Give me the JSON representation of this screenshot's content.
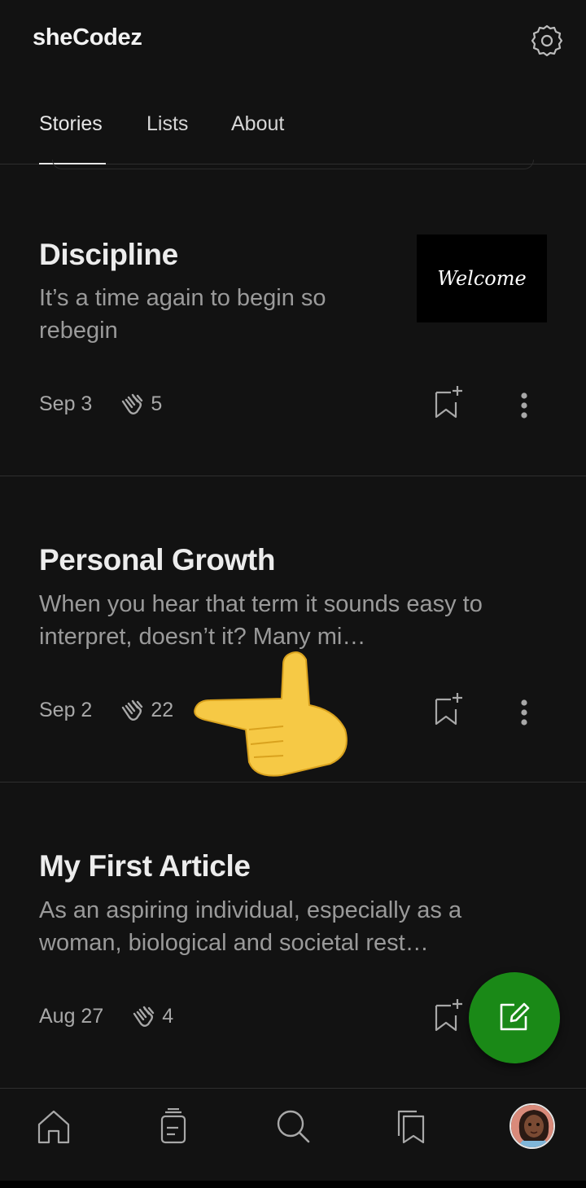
{
  "app": {
    "title": "sheCodez"
  },
  "tabs": [
    {
      "label": "Stories",
      "active": true
    },
    {
      "label": "Lists",
      "active": false
    },
    {
      "label": "About",
      "active": false
    }
  ],
  "stories": [
    {
      "title": "Discipline",
      "subtitle": "It’s a time again to begin so rebegin",
      "date": "Sep 3",
      "claps": "5",
      "thumbnail_text": "Welcome"
    },
    {
      "title": "Personal Growth",
      "subtitle": "When you hear that term it sounds easy to interpret, doesn’t it? Many mi…",
      "date": "Sep 2",
      "claps": "22"
    },
    {
      "title": "My First Article",
      "subtitle": "As an aspiring individual, especially as a woman, biological and societal rest…",
      "date": "Aug 27",
      "claps": "4"
    }
  ],
  "icons": {
    "settings": "gear-icon",
    "clap": "clap-icon",
    "bookmark": "bookmark-add-icon",
    "more": "more-vertical-icon",
    "write": "write-icon",
    "nav": [
      "home-icon",
      "drafts-icon",
      "search-icon",
      "library-icon",
      "profile-avatar"
    ]
  },
  "colors": {
    "background": "#121212",
    "accent": "#1a8917",
    "text": "#e6e6e6",
    "muted": "#9a9a9a"
  }
}
